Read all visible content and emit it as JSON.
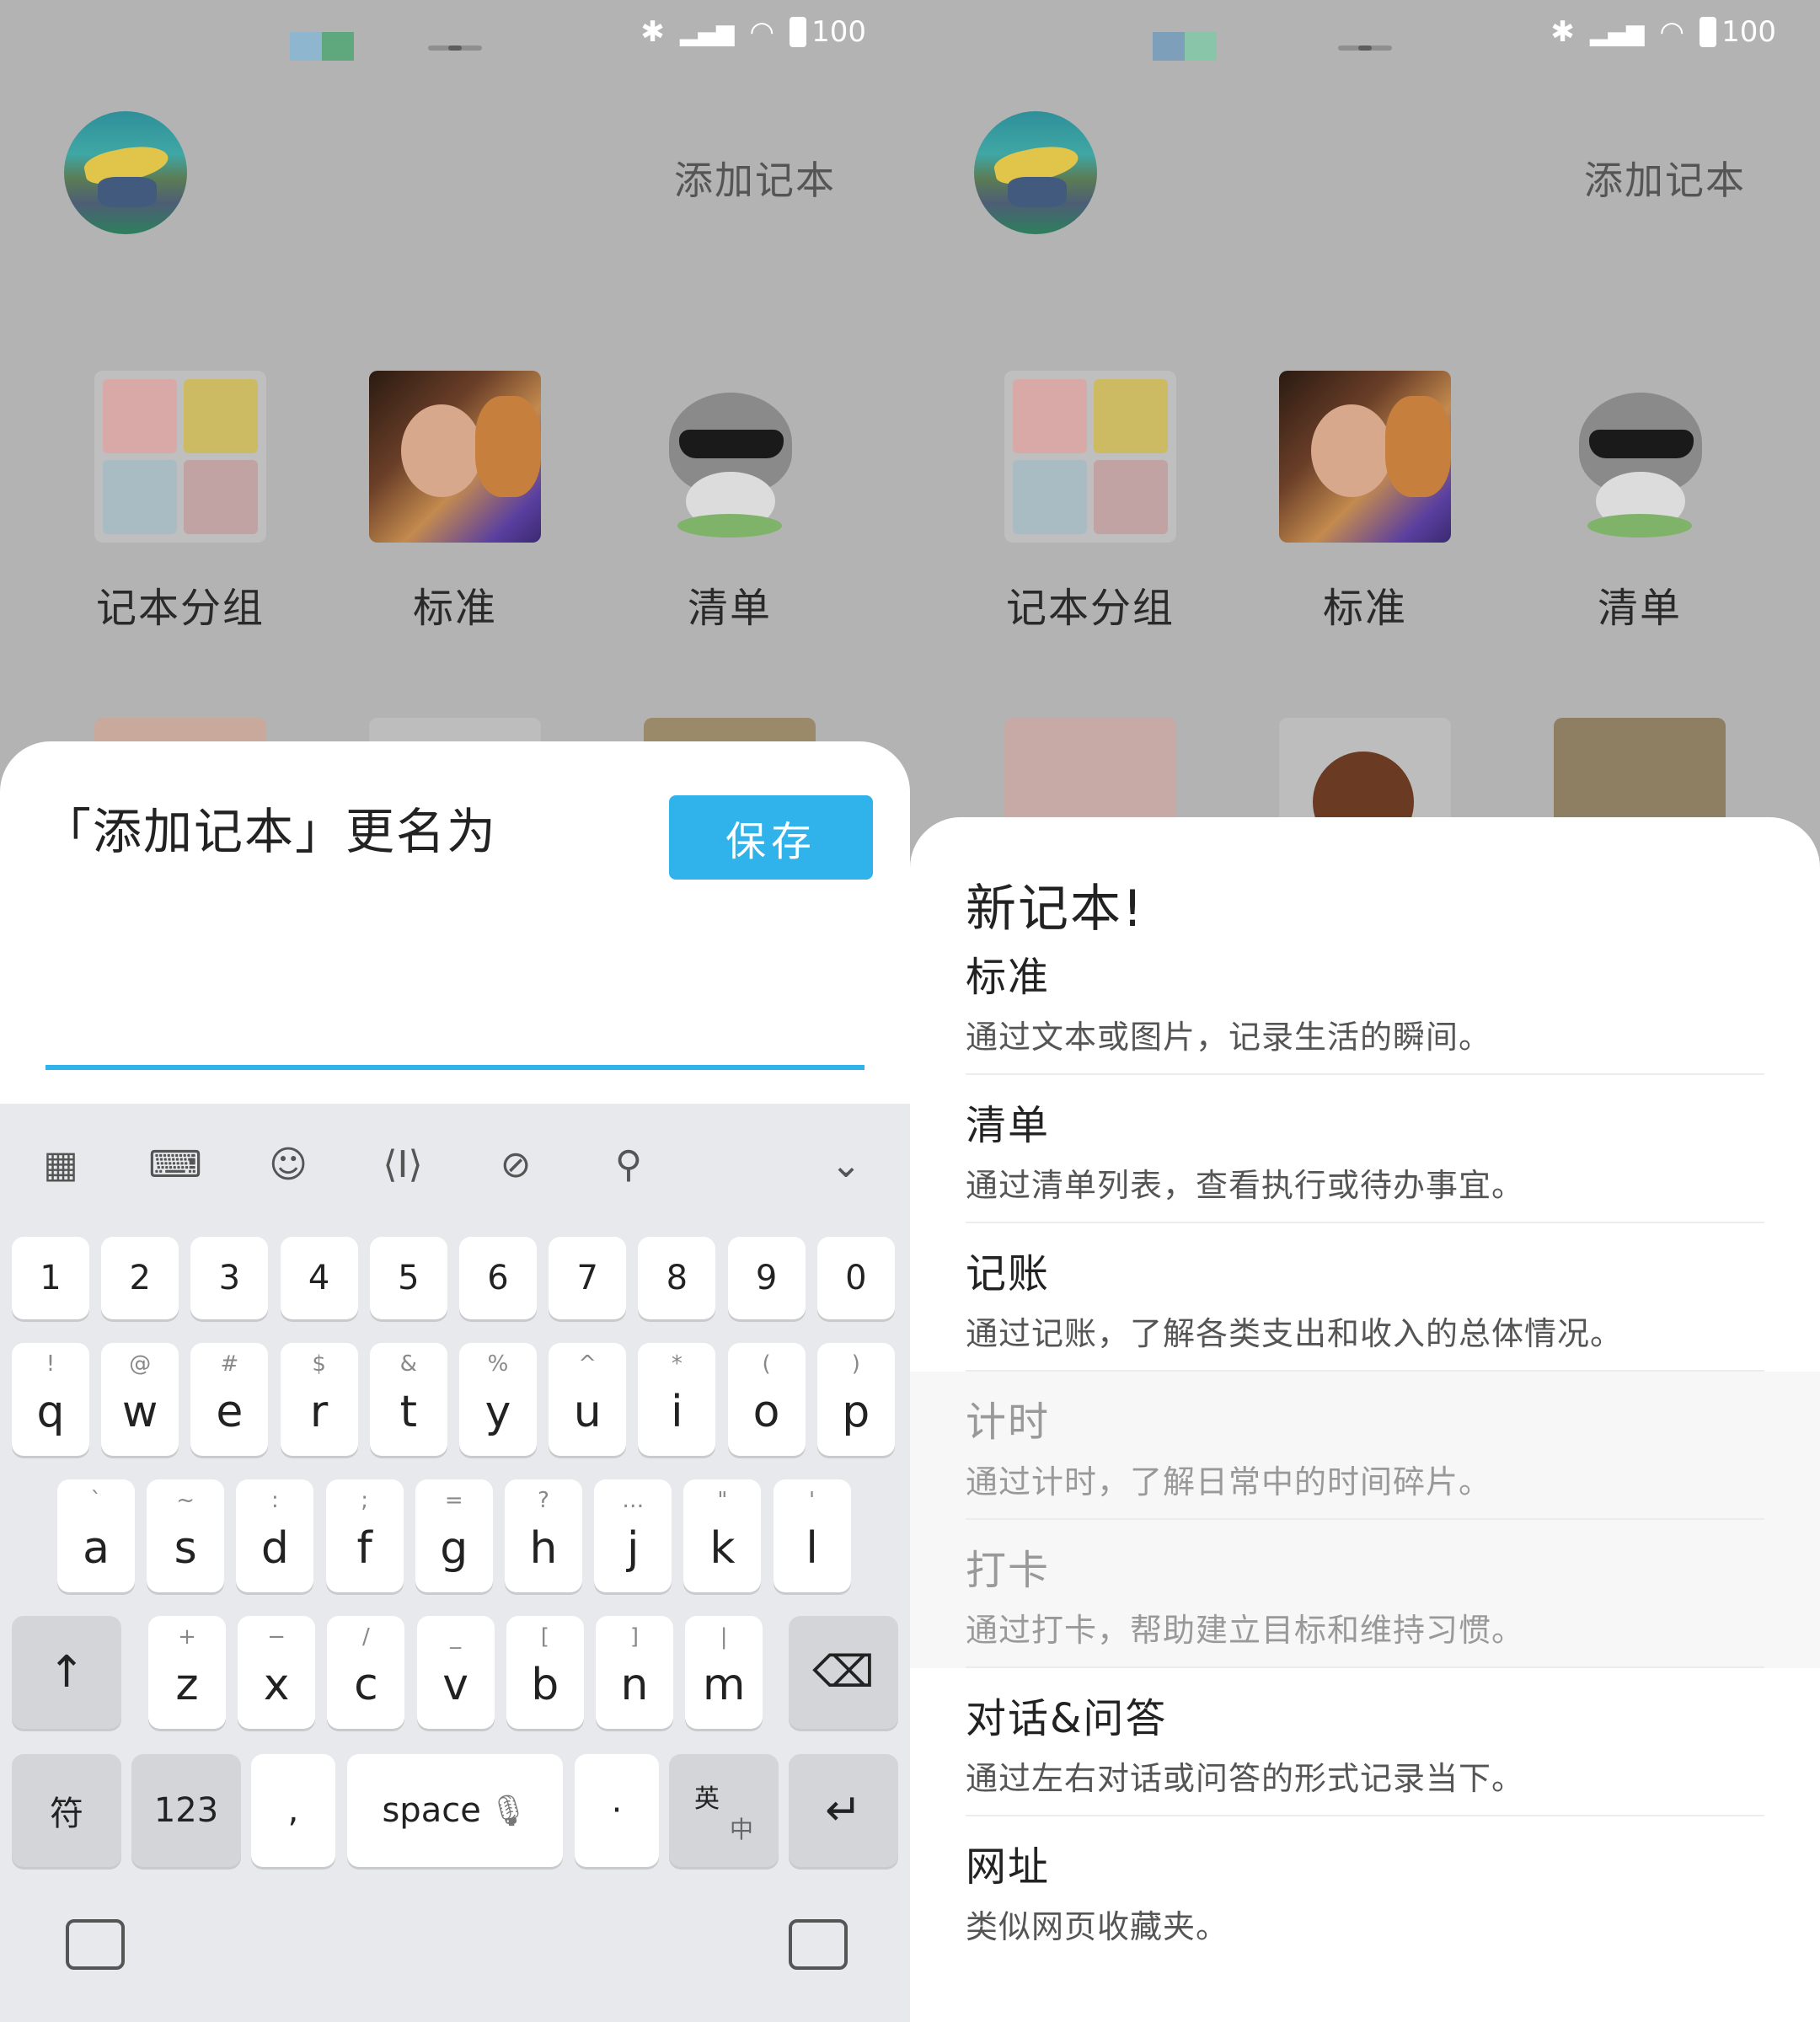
{
  "status_bar": {
    "battery": "100"
  },
  "header": {
    "add_notebook": "添加记本"
  },
  "grid": [
    {
      "label": "记本分组",
      "icon": "group-icon"
    },
    {
      "label": "标准",
      "icon": "photo-thumb"
    },
    {
      "label": "清单",
      "icon": "raccoon-thumb"
    }
  ],
  "rename_dialog": {
    "title": "「添加记本」更名为",
    "save_label": "保存",
    "input_value": ""
  },
  "keyboard": {
    "toolbar": [
      "apps-icon",
      "keypad-icon",
      "emoji-icon",
      "cursor-icon",
      "link-icon",
      "search-icon",
      "chevron-down-icon"
    ],
    "numbers": [
      "1",
      "2",
      "3",
      "4",
      "5",
      "6",
      "7",
      "8",
      "9",
      "0"
    ],
    "row1": [
      {
        "k": "q",
        "s": "!"
      },
      {
        "k": "w",
        "s": "@"
      },
      {
        "k": "e",
        "s": "#"
      },
      {
        "k": "r",
        "s": "$"
      },
      {
        "k": "t",
        "s": "&"
      },
      {
        "k": "y",
        "s": "%"
      },
      {
        "k": "u",
        "s": "^"
      },
      {
        "k": "i",
        "s": "*"
      },
      {
        "k": "o",
        "s": "("
      },
      {
        "k": "p",
        "s": ")"
      }
    ],
    "row2": [
      {
        "k": "a",
        "s": "`"
      },
      {
        "k": "s",
        "s": "~"
      },
      {
        "k": "d",
        "s": ":"
      },
      {
        "k": "f",
        "s": ";"
      },
      {
        "k": "g",
        "s": "="
      },
      {
        "k": "h",
        "s": "?"
      },
      {
        "k": "j",
        "s": "…"
      },
      {
        "k": "k",
        "s": "\""
      },
      {
        "k": "l",
        "s": "'"
      }
    ],
    "row3": [
      {
        "k": "z",
        "s": "+"
      },
      {
        "k": "x",
        "s": "−"
      },
      {
        "k": "c",
        "s": "/"
      },
      {
        "k": "v",
        "s": "_"
      },
      {
        "k": "b",
        "s": "["
      },
      {
        "k": "n",
        "s": "]"
      },
      {
        "k": "m",
        "s": "|"
      }
    ],
    "shift": "↑",
    "backspace": "⌫",
    "symbols": "符",
    "numeric": "123",
    "comma": ",",
    "space": "space",
    "period": "·",
    "lang_top": "英",
    "lang_bottom": "中",
    "enter": "↵"
  },
  "new_notebook_sheet": {
    "title": "新记本!",
    "options": [
      {
        "name": "标准",
        "desc": "通过文本或图片，记录生活的瞬间。",
        "enabled": true
      },
      {
        "name": "清单",
        "desc": "通过清单列表，查看执行或待办事宜。",
        "enabled": true
      },
      {
        "name": "记账",
        "desc": "通过记账，了解各类支出和收入的总体情况。",
        "enabled": true
      },
      {
        "name": "计时",
        "desc": "通过计时，了解日常中的时间碎片。",
        "enabled": false
      },
      {
        "name": "打卡",
        "desc": "通过打卡，帮助建立目标和维持习惯。",
        "enabled": false
      },
      {
        "name": "对话&问答",
        "desc": "通过左右对话或问答的形式记录当下。",
        "enabled": true
      },
      {
        "name": "网址",
        "desc": "类似网页收藏夹。",
        "enabled": true
      }
    ]
  },
  "colors": {
    "accent": "#2fb3ea",
    "dim_overlay": "#b3b3b3"
  }
}
